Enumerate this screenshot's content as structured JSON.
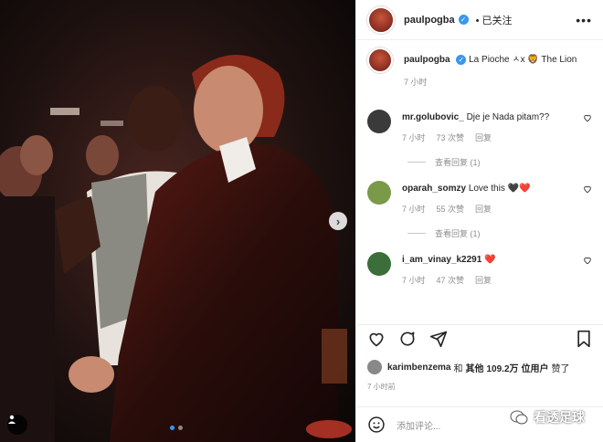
{
  "post": {
    "username": "paulpogba",
    "follow_label": "已关注",
    "more_label": "•••"
  },
  "caption": {
    "username": "paulpogba",
    "text": "La Pioche ㅅx 🦁 The Lion",
    "time": "7 小时"
  },
  "comments": [
    {
      "username": "mr.golubovic_",
      "text": "Dje je Nada pitam??",
      "time": "7 小时",
      "likes": "73 次赞",
      "reply_label": "回复",
      "view_replies": "查看回复 (1)",
      "avatar_color": "#3a3a3a"
    },
    {
      "username": "oparah_somzy",
      "text": "Love this 🖤❤️",
      "time": "7 小时",
      "likes": "55 次赞",
      "reply_label": "回复",
      "view_replies": "查看回复 (1)",
      "avatar_color": "#7a9a4a"
    },
    {
      "username": "i_am_vinay_k2291",
      "text": "❤️",
      "time": "7 小时",
      "likes": "47 次赞",
      "reply_label": "回复",
      "avatar_color": "#3b6e3a"
    }
  ],
  "likes_line": {
    "user": "karimbenzema",
    "and": "和",
    "others": "其他",
    "count": "109.2万",
    "suffix": "位用户",
    "liked": "赞了"
  },
  "post_time": "7 小时前",
  "add_comment_placeholder": "添加评论...",
  "watermark": "看透足球",
  "colors": {
    "verified": "#3897f0",
    "heart": "#ed4956",
    "muted": "#8e8e8e"
  }
}
